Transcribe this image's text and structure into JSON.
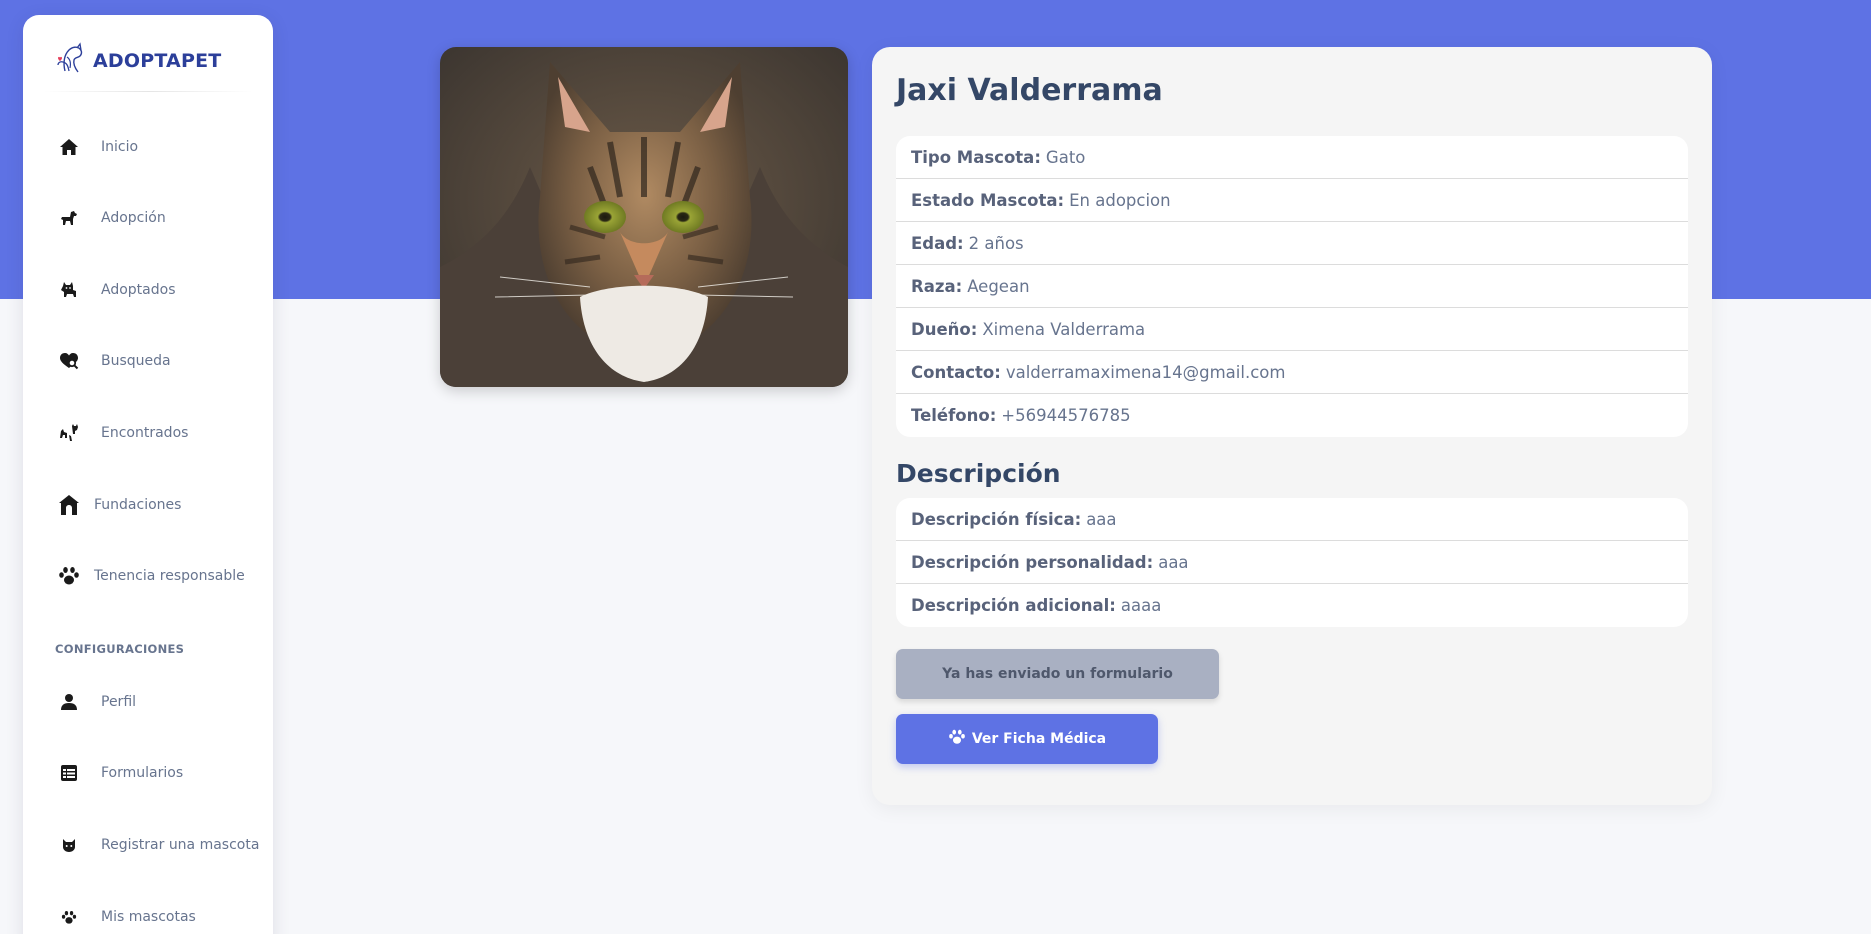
{
  "brand": {
    "name": "ADOPTAPET",
    "logo_icon": "dog-cat-logo-icon"
  },
  "sidebar": {
    "items": [
      {
        "label": "Inicio",
        "icon": "home-icon"
      },
      {
        "label": "Adopción",
        "icon": "dog-icon"
      },
      {
        "label": "Adoptados",
        "icon": "cat-icon"
      },
      {
        "label": "Busqueda",
        "icon": "search-heart-icon"
      },
      {
        "label": "Encontrados",
        "icon": "dog-cat-icon"
      },
      {
        "label": "Fundaciones",
        "icon": "shelter-house-icon"
      },
      {
        "label": "Tenencia responsable",
        "icon": "paw-icon"
      }
    ],
    "settings_title": "CONFIGURACIONES",
    "settings_items": [
      {
        "label": "Perfil",
        "icon": "user-icon"
      },
      {
        "label": "Formularios",
        "icon": "table-icon"
      },
      {
        "label": "Registrar una mascota",
        "icon": "cat-face-icon"
      },
      {
        "label": "Mis mascotas",
        "icon": "paw-icon"
      }
    ]
  },
  "pet": {
    "name": "Jaxi Valderrama",
    "photo_alt": "cat-photo",
    "details": [
      {
        "key": "Tipo Mascota:",
        "value": "Gato"
      },
      {
        "key": "Estado Mascota:",
        "value": "En adopcion"
      },
      {
        "key": "Edad:",
        "value": "2 años"
      },
      {
        "key": "Raza:",
        "value": "Aegean"
      },
      {
        "key": "Dueño:",
        "value": "Ximena Valderrama"
      },
      {
        "key": "Contacto:",
        "value": "valderramaximena14@gmail.com"
      },
      {
        "key": "Teléfono:",
        "value": "+56944576785"
      }
    ],
    "description_title": "Descripción",
    "descriptions": [
      {
        "key": "Descripción física:",
        "value": "aaa"
      },
      {
        "key": "Descripción personalidad:",
        "value": "aaa"
      },
      {
        "key": "Descripción adicional:",
        "value": "aaaa"
      }
    ]
  },
  "actions": {
    "sent_label": "Ya has enviado un formulario",
    "ficha_label": "Ver Ficha Médica",
    "ficha_icon": "paw-icon"
  },
  "colors": {
    "primary": "#5e72e4",
    "brand_text": "#2c3f9a",
    "disabled_button": "#a9b0c2"
  }
}
